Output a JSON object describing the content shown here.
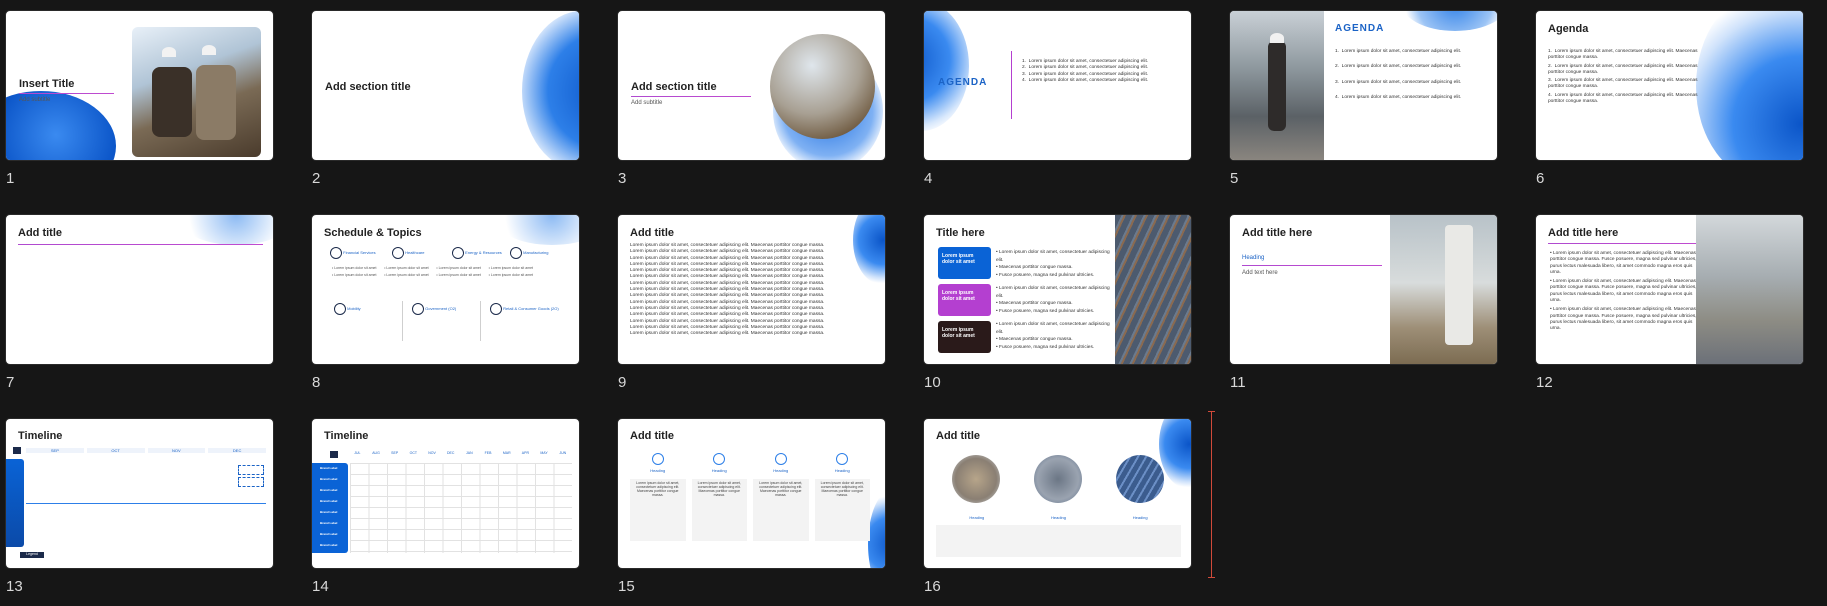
{
  "slides": [
    {
      "number": "1",
      "title": "Insert Title",
      "subtitle": "Add subtitle"
    },
    {
      "number": "2",
      "title": "Add section title"
    },
    {
      "number": "3",
      "title": "Add section title",
      "subtitle": "Add subtitle"
    },
    {
      "number": "4",
      "title": "AGENDA",
      "items": [
        "Lorem ipsum dolor sit amet, consectetuer adipiscing elit.",
        "Lorem ipsum dolor sit amet, consectetuer adipiscing elit.",
        "Lorem ipsum dolor sit amet, consectetuer adipiscing elit.",
        "Lorem ipsum dolor sit amet, consectetuer adipiscing elit."
      ]
    },
    {
      "number": "5",
      "title": "AGENDA",
      "items": [
        "Lorem ipsum dolor sit amet, consectetuer adipiscing elit.",
        "Lorem ipsum dolor sit amet, consectetuer adipiscing elit.",
        "Lorem ipsum dolor sit amet, consectetuer adipiscing elit.",
        "Lorem ipsum dolor sit amet, consectetuer adipiscing elit."
      ]
    },
    {
      "number": "6",
      "title": "Agenda",
      "items": [
        "Lorem ipsum dolor sit amet, consectetuer adipiscing elit. Maecenas porttitor congue massa.",
        "Lorem ipsum dolor sit amet, consectetuer adipiscing elit. Maecenas porttitor congue massa.",
        "Lorem ipsum dolor sit amet, consectetuer adipiscing elit. Maecenas porttitor congue massa.",
        "Lorem ipsum dolor sit amet, consectetuer adipiscing elit. Maecenas porttitor congue massa."
      ]
    },
    {
      "number": "7",
      "title": "Add title"
    },
    {
      "number": "8",
      "title": "Schedule & Topics",
      "topics": [
        "Financial Services",
        "Healthcare",
        "Energy & Resources",
        "Manufacturing",
        "Mobility",
        "Government (O2)",
        "Retail & Consumer Goods (2O)"
      ],
      "bullet": "Lorem ipsum dolor sit amet"
    },
    {
      "number": "9",
      "title": "Add title",
      "para": "Lorem ipsum dolor sit amet, consectetuer adipiscing elit. Maecenas porttitor congue massa."
    },
    {
      "number": "10",
      "title": "Title here",
      "box": "Lorem ipsum dolor sit amet",
      "lines": [
        "Lorem ipsum dolor sit amet, consectetuer adipiscing elit.",
        "Maecenas porttitor congue massa.",
        "Fusce posuere, magna sed pulvinar ultricies."
      ]
    },
    {
      "number": "11",
      "title": "Add title here",
      "heading": "Heading",
      "text": "Add text here"
    },
    {
      "number": "12",
      "title": "Add title here",
      "para": "Lorem ipsum dolor sit amet, consectetuer adipiscing elit. Maecenas porttitor congue massa. Fusce posuere, magna sed pulvinar ultricies, purus lectus malesuada libero, sit amet commodo magna eros quis urna."
    },
    {
      "number": "13",
      "title": "Timeline",
      "months": [
        "SEP",
        "OCT",
        "NOV",
        "DEC"
      ],
      "legend": "Legend"
    },
    {
      "number": "14",
      "title": "Timeline",
      "months": [
        "JUL",
        "AUG",
        "SEP",
        "OCT",
        "NOV",
        "DEC",
        "JAN",
        "FEB",
        "MAR",
        "APR",
        "MAY",
        "JUN"
      ],
      "row": "Brand Label"
    },
    {
      "number": "15",
      "title": "Add title",
      "heading": "Heading",
      "para": "Lorem ipsum dolor sit amet, consectetuer adipiscing elit. Maecenas porttitor congue massa."
    },
    {
      "number": "16",
      "title": "Add title",
      "heading": "Heading"
    }
  ],
  "colors": {
    "accent": "#0a63d6",
    "purple": "#b43fd0",
    "dark": "#2a1a1a",
    "bg": "#161616"
  }
}
